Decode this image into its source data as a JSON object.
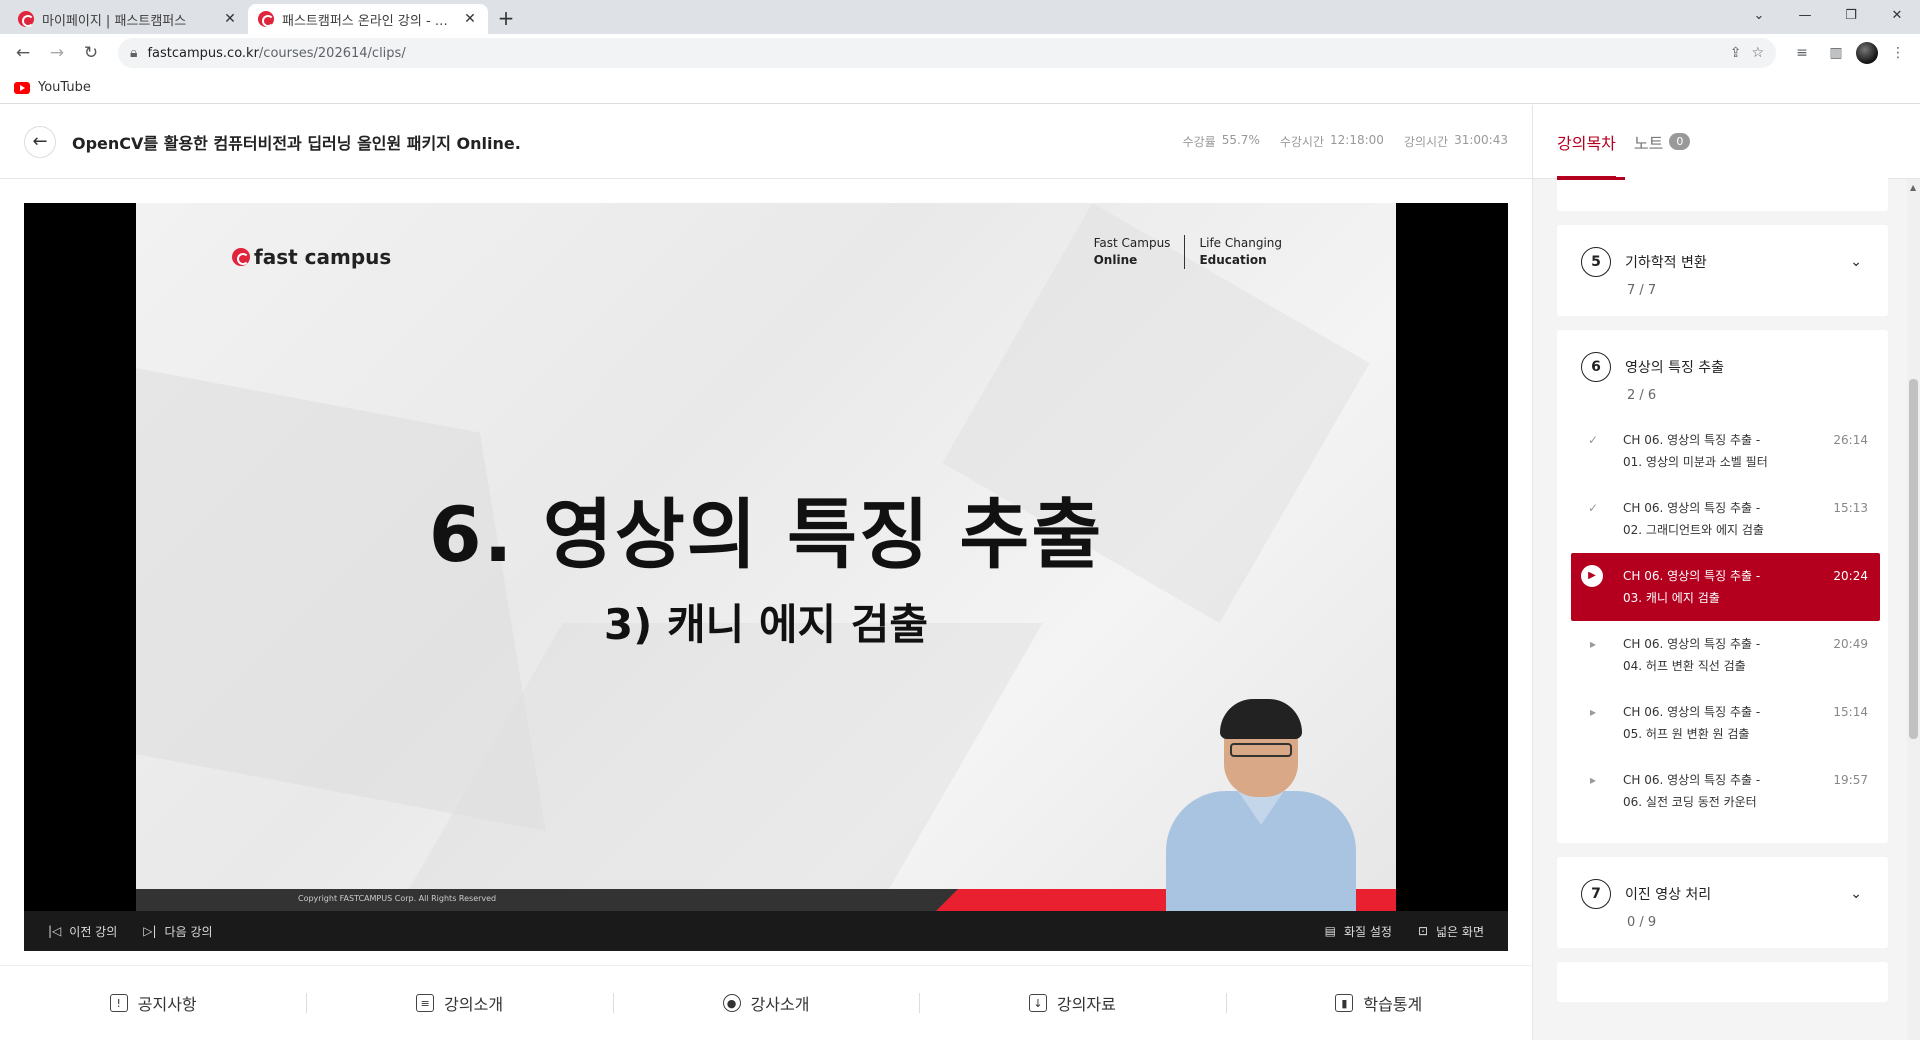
{
  "browser": {
    "tabs": [
      {
        "title": "마이페이지 | 패스트캠퍼스",
        "close": "✕"
      },
      {
        "title": "패스트캠퍼스 온라인 강의 - 영상 시청",
        "close": "✕"
      }
    ],
    "new_tab": "+",
    "url_host": "fastcampus.co.kr",
    "url_path": "/courses/202614/clips/",
    "bookmark": "YouTube"
  },
  "header": {
    "title": "OpenCV를 활용한 컴퓨터비전과 딥러닝 올인원 패키지 Online.",
    "stats": [
      {
        "label": "수강률",
        "value": "55.7%"
      },
      {
        "label": "수강시간",
        "value": "12:18:00"
      },
      {
        "label": "강의시간",
        "value": "31:00:43"
      }
    ]
  },
  "slide": {
    "logo": "fast campus",
    "tag1_line1": "Fast Campus",
    "tag1_line2": "Online",
    "tag2_line1": "Life Changing",
    "tag2_line2": "Education",
    "title": "6. 영상의 특징 추출",
    "subtitle": "3) 캐니 에지 검출",
    "copyright": "Copyright FASTCAMPUS Corp. All Rights Reserved"
  },
  "controls": {
    "prev": "이전 강의",
    "next": "다음 강의",
    "quality": "화질 설정",
    "wide": "넓은 화면"
  },
  "bottom_tabs": [
    "공지사항",
    "강의소개",
    "강사소개",
    "강의자료",
    "학습통계"
  ],
  "sidebar": {
    "tab_toc": "강의목차",
    "tab_note": "노트",
    "note_count": "0",
    "chapters": [
      {
        "num": "5",
        "title": "기하학적 변환",
        "count": "7  /  7"
      },
      {
        "num": "6",
        "title": "영상의 특징 추출",
        "count": "2  /  6",
        "lessons": [
          {
            "line1": "CH 06. 영상의 특징 추출 -",
            "line2": "01. 영상의 미분과 소벨 필터",
            "duration": "26:14",
            "state": "done"
          },
          {
            "line1": "CH 06. 영상의 특징 추출 -",
            "line2": "02. 그래디언트와 에지 검출",
            "duration": "15:13",
            "state": "done"
          },
          {
            "line1": "CH 06. 영상의 특징 추출 -",
            "line2": "03. 캐니 에지 검출",
            "duration": "20:24",
            "state": "active"
          },
          {
            "line1": "CH 06. 영상의 특징 추출 -",
            "line2": "04. 허프 변환 직선 검출",
            "duration": "20:49",
            "state": "todo"
          },
          {
            "line1": "CH 06. 영상의 특징 추출 -",
            "line2": "05. 허프 원 변환 원 검출",
            "duration": "15:14",
            "state": "todo"
          },
          {
            "line1": "CH 06. 영상의 특징 추출 -",
            "line2": "06. 실전 코딩 동전 카운터",
            "duration": "19:57",
            "state": "todo"
          }
        ]
      },
      {
        "num": "7",
        "title": "이진 영상 처리",
        "count": "0  /  9"
      }
    ]
  },
  "colors": {
    "accent": "#b4001e",
    "brand_red": "#e0243b"
  }
}
